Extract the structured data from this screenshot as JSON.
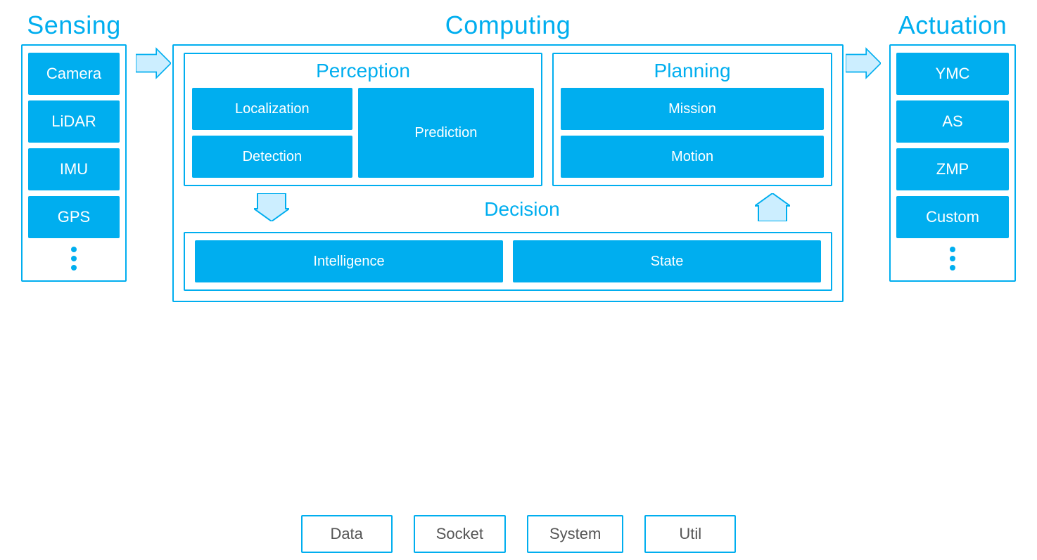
{
  "sensing": {
    "title": "Sensing",
    "items": [
      "Camera",
      "LiDAR",
      "IMU",
      "GPS"
    ]
  },
  "computing": {
    "title": "Computing",
    "perception": {
      "title": "Perception",
      "localization": "Localization",
      "detection": "Detection",
      "prediction": "Prediction"
    },
    "planning": {
      "title": "Planning",
      "mission": "Mission",
      "motion": "Motion"
    },
    "decision": {
      "title": "Decision",
      "intelligence": "Intelligence",
      "state": "State"
    }
  },
  "actuation": {
    "title": "Actuation",
    "items": [
      "YMC",
      "AS",
      "ZMP",
      "Custom"
    ]
  },
  "utilities": [
    "Data",
    "Socket",
    "System",
    "Util"
  ]
}
